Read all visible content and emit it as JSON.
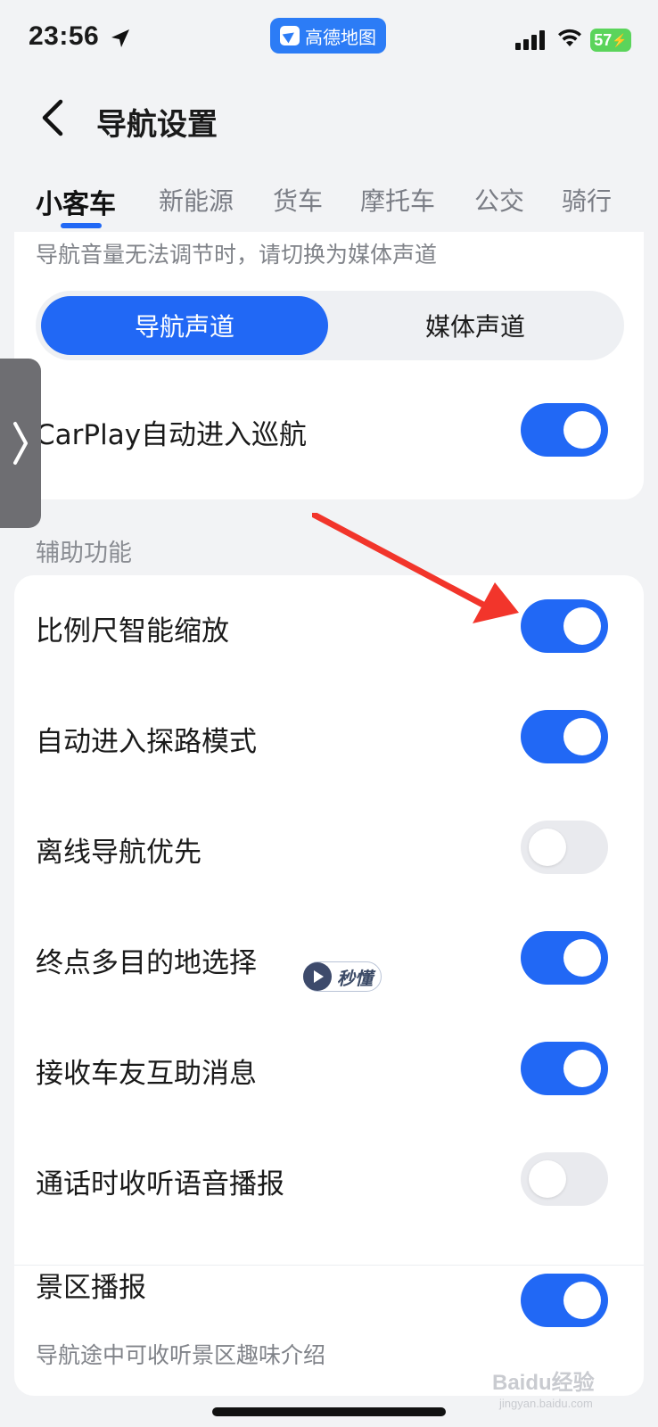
{
  "status_bar": {
    "time": "23:56",
    "app_name": "高德地图",
    "battery": "57"
  },
  "header": {
    "title": "导航设置"
  },
  "tabs": [
    {
      "label": "小客车",
      "active": true
    },
    {
      "label": "新能源"
    },
    {
      "label": "货车"
    },
    {
      "label": "摩托车"
    },
    {
      "label": "公交"
    },
    {
      "label": "骑行"
    }
  ],
  "voice_channel": {
    "hint": "导航音量无法调节时，请切换为媒体声道",
    "options": [
      "导航声道",
      "媒体声道"
    ],
    "selected": "导航声道"
  },
  "carplay": {
    "label": "CarPlay自动进入巡航",
    "enabled": true
  },
  "assist": {
    "section_title": "辅助功能",
    "items": [
      {
        "label": "比例尺智能缩放",
        "enabled": true
      },
      {
        "label": "自动进入探路模式",
        "enabled": true
      },
      {
        "label": "离线导航优先",
        "enabled": false
      },
      {
        "label": "终点多目的地选择",
        "enabled": true,
        "badge": "秒懂"
      },
      {
        "label": "接收车友互助消息",
        "enabled": true
      },
      {
        "label": "通话时收听语音播报",
        "enabled": false
      },
      {
        "label": "景区播报",
        "enabled": true,
        "sublabel": "导航途中可收听景区趣味介绍"
      }
    ]
  },
  "watermark": {
    "text": "Baidu经验",
    "sub": "jingyan.baidu.com"
  },
  "colors": {
    "accent": "#2168f5",
    "annotation_arrow": "#f2352b"
  }
}
